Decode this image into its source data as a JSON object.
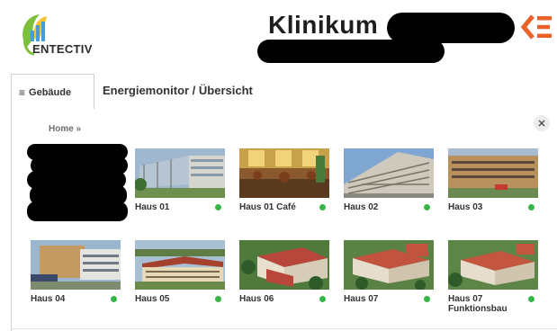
{
  "header": {
    "logo_text": "ENTECTIV",
    "site_title": "Klinikum"
  },
  "tabs": {
    "gebaeude_label": "Gebäude",
    "page_title": "Energiemonitor / Übersicht"
  },
  "breadcrumb": "Home »",
  "buildings": [
    {
      "name": "Haus 01",
      "status": "online"
    },
    {
      "name": "Haus 01 Café",
      "status": "online"
    },
    {
      "name": "Haus 02",
      "status": "online"
    },
    {
      "name": "Haus 03",
      "status": "online"
    },
    {
      "name": "Haus 04",
      "status": "online"
    },
    {
      "name": "Haus 05",
      "status": "online"
    },
    {
      "name": "Haus 06",
      "status": "online"
    },
    {
      "name": "Haus 07",
      "status": "online"
    },
    {
      "name": "Haus 07 Funktionsbau",
      "status": "online"
    }
  ],
  "colors": {
    "status_online": "#3bb54a",
    "brand_orange": "#e8622a",
    "logo_green": "#7cbf3a",
    "logo_yellow": "#f2c230"
  },
  "icons": {
    "menu": "hamburger-icon",
    "close": "close-icon",
    "logo": "entectiv-logo",
    "brand": "brand-mark-icon"
  }
}
